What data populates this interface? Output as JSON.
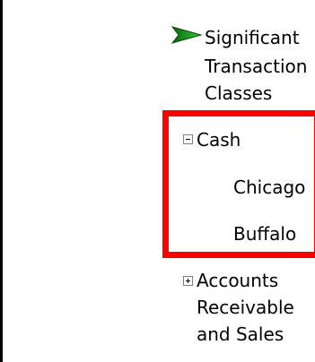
{
  "tree": {
    "significant_transaction_classes": {
      "label_line1": "Significant",
      "label_line2": "Transaction",
      "label_line3": "Classes",
      "icon": "arrow-right-icon",
      "icon_color": "#0a7f12"
    },
    "cash": {
      "toggle": "minus",
      "label": "Cash",
      "children": [
        "Chicago",
        "Buffalo"
      ]
    },
    "accounts_receivable": {
      "toggle": "plus",
      "label_line1": "Accounts",
      "label_line2": "Receivable",
      "label_line3": "and Sales"
    }
  },
  "highlight": {
    "color": "#ff0000"
  }
}
